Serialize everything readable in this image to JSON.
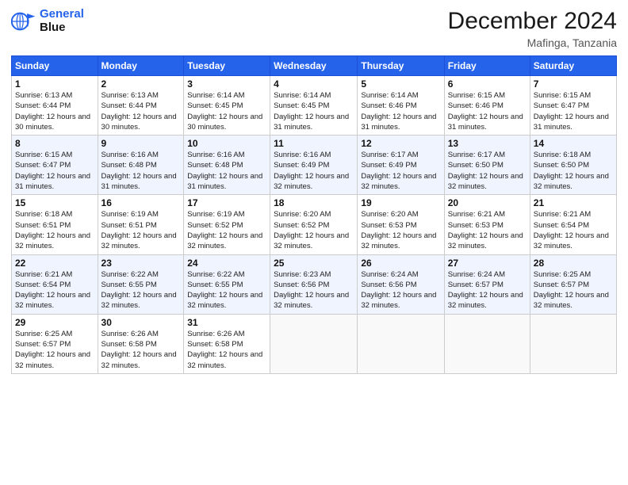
{
  "header": {
    "logo_line1": "General",
    "logo_line2": "Blue",
    "month_title": "December 2024",
    "location": "Mafinga, Tanzania"
  },
  "days_of_week": [
    "Sunday",
    "Monday",
    "Tuesday",
    "Wednesday",
    "Thursday",
    "Friday",
    "Saturday"
  ],
  "weeks": [
    [
      {
        "day": "1",
        "sunrise": "6:13 AM",
        "sunset": "6:44 PM",
        "daylight": "12 hours and 30 minutes."
      },
      {
        "day": "2",
        "sunrise": "6:13 AM",
        "sunset": "6:44 PM",
        "daylight": "12 hours and 30 minutes."
      },
      {
        "day": "3",
        "sunrise": "6:14 AM",
        "sunset": "6:45 PM",
        "daylight": "12 hours and 30 minutes."
      },
      {
        "day": "4",
        "sunrise": "6:14 AM",
        "sunset": "6:45 PM",
        "daylight": "12 hours and 31 minutes."
      },
      {
        "day": "5",
        "sunrise": "6:14 AM",
        "sunset": "6:46 PM",
        "daylight": "12 hours and 31 minutes."
      },
      {
        "day": "6",
        "sunrise": "6:15 AM",
        "sunset": "6:46 PM",
        "daylight": "12 hours and 31 minutes."
      },
      {
        "day": "7",
        "sunrise": "6:15 AM",
        "sunset": "6:47 PM",
        "daylight": "12 hours and 31 minutes."
      }
    ],
    [
      {
        "day": "8",
        "sunrise": "6:15 AM",
        "sunset": "6:47 PM",
        "daylight": "12 hours and 31 minutes."
      },
      {
        "day": "9",
        "sunrise": "6:16 AM",
        "sunset": "6:48 PM",
        "daylight": "12 hours and 31 minutes."
      },
      {
        "day": "10",
        "sunrise": "6:16 AM",
        "sunset": "6:48 PM",
        "daylight": "12 hours and 31 minutes."
      },
      {
        "day": "11",
        "sunrise": "6:16 AM",
        "sunset": "6:49 PM",
        "daylight": "12 hours and 32 minutes."
      },
      {
        "day": "12",
        "sunrise": "6:17 AM",
        "sunset": "6:49 PM",
        "daylight": "12 hours and 32 minutes."
      },
      {
        "day": "13",
        "sunrise": "6:17 AM",
        "sunset": "6:50 PM",
        "daylight": "12 hours and 32 minutes."
      },
      {
        "day": "14",
        "sunrise": "6:18 AM",
        "sunset": "6:50 PM",
        "daylight": "12 hours and 32 minutes."
      }
    ],
    [
      {
        "day": "15",
        "sunrise": "6:18 AM",
        "sunset": "6:51 PM",
        "daylight": "12 hours and 32 minutes."
      },
      {
        "day": "16",
        "sunrise": "6:19 AM",
        "sunset": "6:51 PM",
        "daylight": "12 hours and 32 minutes."
      },
      {
        "day": "17",
        "sunrise": "6:19 AM",
        "sunset": "6:52 PM",
        "daylight": "12 hours and 32 minutes."
      },
      {
        "day": "18",
        "sunrise": "6:20 AM",
        "sunset": "6:52 PM",
        "daylight": "12 hours and 32 minutes."
      },
      {
        "day": "19",
        "sunrise": "6:20 AM",
        "sunset": "6:53 PM",
        "daylight": "12 hours and 32 minutes."
      },
      {
        "day": "20",
        "sunrise": "6:21 AM",
        "sunset": "6:53 PM",
        "daylight": "12 hours and 32 minutes."
      },
      {
        "day": "21",
        "sunrise": "6:21 AM",
        "sunset": "6:54 PM",
        "daylight": "12 hours and 32 minutes."
      }
    ],
    [
      {
        "day": "22",
        "sunrise": "6:21 AM",
        "sunset": "6:54 PM",
        "daylight": "12 hours and 32 minutes."
      },
      {
        "day": "23",
        "sunrise": "6:22 AM",
        "sunset": "6:55 PM",
        "daylight": "12 hours and 32 minutes."
      },
      {
        "day": "24",
        "sunrise": "6:22 AM",
        "sunset": "6:55 PM",
        "daylight": "12 hours and 32 minutes."
      },
      {
        "day": "25",
        "sunrise": "6:23 AM",
        "sunset": "6:56 PM",
        "daylight": "12 hours and 32 minutes."
      },
      {
        "day": "26",
        "sunrise": "6:24 AM",
        "sunset": "6:56 PM",
        "daylight": "12 hours and 32 minutes."
      },
      {
        "day": "27",
        "sunrise": "6:24 AM",
        "sunset": "6:57 PM",
        "daylight": "12 hours and 32 minutes."
      },
      {
        "day": "28",
        "sunrise": "6:25 AM",
        "sunset": "6:57 PM",
        "daylight": "12 hours and 32 minutes."
      }
    ],
    [
      {
        "day": "29",
        "sunrise": "6:25 AM",
        "sunset": "6:57 PM",
        "daylight": "12 hours and 32 minutes."
      },
      {
        "day": "30",
        "sunrise": "6:26 AM",
        "sunset": "6:58 PM",
        "daylight": "12 hours and 32 minutes."
      },
      {
        "day": "31",
        "sunrise": "6:26 AM",
        "sunset": "6:58 PM",
        "daylight": "12 hours and 32 minutes."
      },
      null,
      null,
      null,
      null
    ]
  ],
  "labels": {
    "sunrise": "Sunrise:",
    "sunset": "Sunset:",
    "daylight": "Daylight:"
  }
}
